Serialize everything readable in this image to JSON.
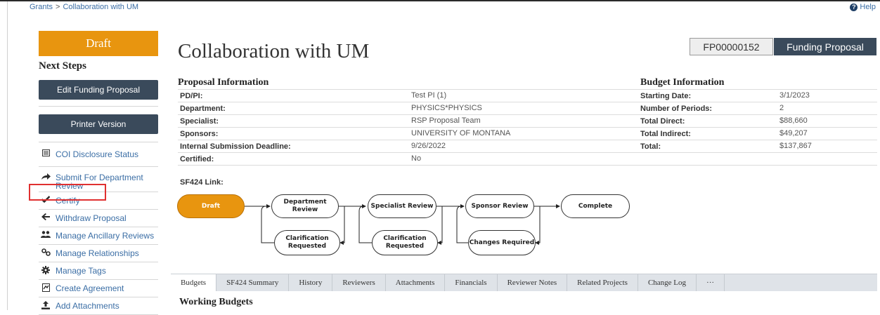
{
  "breadcrumb": {
    "root": "Grants",
    "separator": ">",
    "current": "Collaboration with UM"
  },
  "help": {
    "label": "Help",
    "icon": "help-icon"
  },
  "sidebar": {
    "state": "Draft",
    "next_steps_title": "Next Steps",
    "edit_button": "Edit Funding Proposal",
    "printer_button": "Printer Version",
    "coi": {
      "label": "COI Disclosure Status",
      "icon": "list-icon"
    },
    "actions": [
      {
        "label": "Submit For Department Review",
        "icon": "share-arrow-icon"
      },
      {
        "label": "Certify",
        "icon": "checkmark-icon"
      },
      {
        "label": "Withdraw Proposal",
        "icon": "arrow-left-icon"
      },
      {
        "label": "Manage Ancillary Reviews",
        "icon": "users-icon"
      },
      {
        "label": "Manage Relationships",
        "icon": "link-icon"
      },
      {
        "label": "Manage Tags",
        "icon": "gear-icon"
      },
      {
        "label": "Create Agreement",
        "icon": "document-icon"
      },
      {
        "label": "Add Attachments",
        "icon": "upload-icon"
      }
    ]
  },
  "header": {
    "title": "Collaboration with UM",
    "id": "FP00000152",
    "type": "Funding Proposal"
  },
  "proposal_info": {
    "heading": "Proposal Information",
    "rows": [
      {
        "label": "PD/PI:",
        "value": "Test PI (1)"
      },
      {
        "label": "Department:",
        "value": "PHYSICS*PHYSICS"
      },
      {
        "label": "Specialist:",
        "value": "RSP Proposal Team"
      },
      {
        "label": "Sponsors:",
        "value": "UNIVERSITY OF MONTANA"
      },
      {
        "label": "Internal Submission Deadline:",
        "value": "9/26/2022"
      },
      {
        "label": "Certified:",
        "value": "No"
      }
    ],
    "sf424_label": "SF424 Link:"
  },
  "budget_info": {
    "heading": "Budget Information",
    "rows": [
      {
        "label": "Starting Date:",
        "value": "3/1/2023"
      },
      {
        "label": "Number of Periods:",
        "value": "2"
      },
      {
        "label": "Total Direct:",
        "value": "$88,660"
      },
      {
        "label": "Total Indirect:",
        "value": "$49,207"
      },
      {
        "label": "Total:",
        "value": "$137,867"
      }
    ]
  },
  "workflow": {
    "draft": "Draft",
    "department_review": "Department Review",
    "specialist_review": "Specialist Review",
    "sponsor_review": "Sponsor Review",
    "complete": "Complete",
    "clarification_1": "Clarification Requested",
    "clarification_2": "Clarification Requested",
    "changes_required": "Changes Required"
  },
  "tabs": [
    "Budgets",
    "SF424 Summary",
    "History",
    "Reviewers",
    "Attachments",
    "Financials",
    "Reviewer Notes",
    "Related Projects",
    "Change Log",
    "···"
  ],
  "section_title": "Working Budgets",
  "colors": {
    "state_orange": "#e8950f",
    "button_dark": "#3a4a5b",
    "link_blue": "#3b6ea5",
    "highlight_red": "#e03030"
  }
}
